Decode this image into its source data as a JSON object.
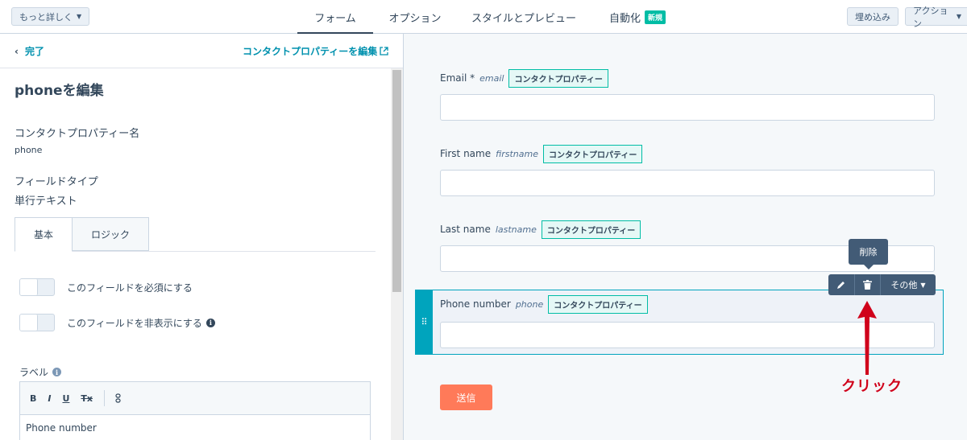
{
  "topbar": {
    "more_label": "もっと詳しく",
    "tabs": [
      {
        "label": "フォーム",
        "active": true
      },
      {
        "label": "オプション"
      },
      {
        "label": "スタイルとプレビュー"
      },
      {
        "label": "自動化",
        "badge": "新規"
      }
    ],
    "embed_label": "埋め込み",
    "action_label": "アクション"
  },
  "left": {
    "back_label": "完了",
    "edit_property_link": "コンタクトプロパティーを編集",
    "title": "phoneを編集",
    "property_name_label": "コンタクトプロパティー名",
    "property_name_value": "phone",
    "field_type_label": "フィールドタイプ",
    "field_type_value": "単行テキスト",
    "tabs": [
      "基本",
      "ロジック"
    ],
    "toggle_required": "このフィールドを必須にする",
    "toggle_hidden": "このフィールドを非表示にする",
    "label_heading": "ラベル",
    "editor_toolbar": [
      "B",
      "I",
      "U",
      "Tx"
    ],
    "editor_text": "Phone number"
  },
  "form": {
    "fields": [
      {
        "label": "Email *",
        "internal": "email",
        "badge": "コンタクトプロパティー"
      },
      {
        "label": "First name",
        "internal": "firstname",
        "badge": "コンタクトプロパティー"
      },
      {
        "label": "Last name",
        "internal": "lastname",
        "badge": "コンタクトプロパティー"
      },
      {
        "label": "Phone number",
        "internal": "phone",
        "badge": "コンタクトプロパティー"
      }
    ],
    "submit_label": "送信",
    "toolbar_more": "その他",
    "tooltip": "削除"
  },
  "annotation": {
    "click_label": "クリック",
    "color": "#d0021b"
  },
  "colors": {
    "accent": "#00a4bd",
    "link": "#0091ae",
    "submit": "#ff7a59",
    "badge_border": "#00bda5"
  }
}
